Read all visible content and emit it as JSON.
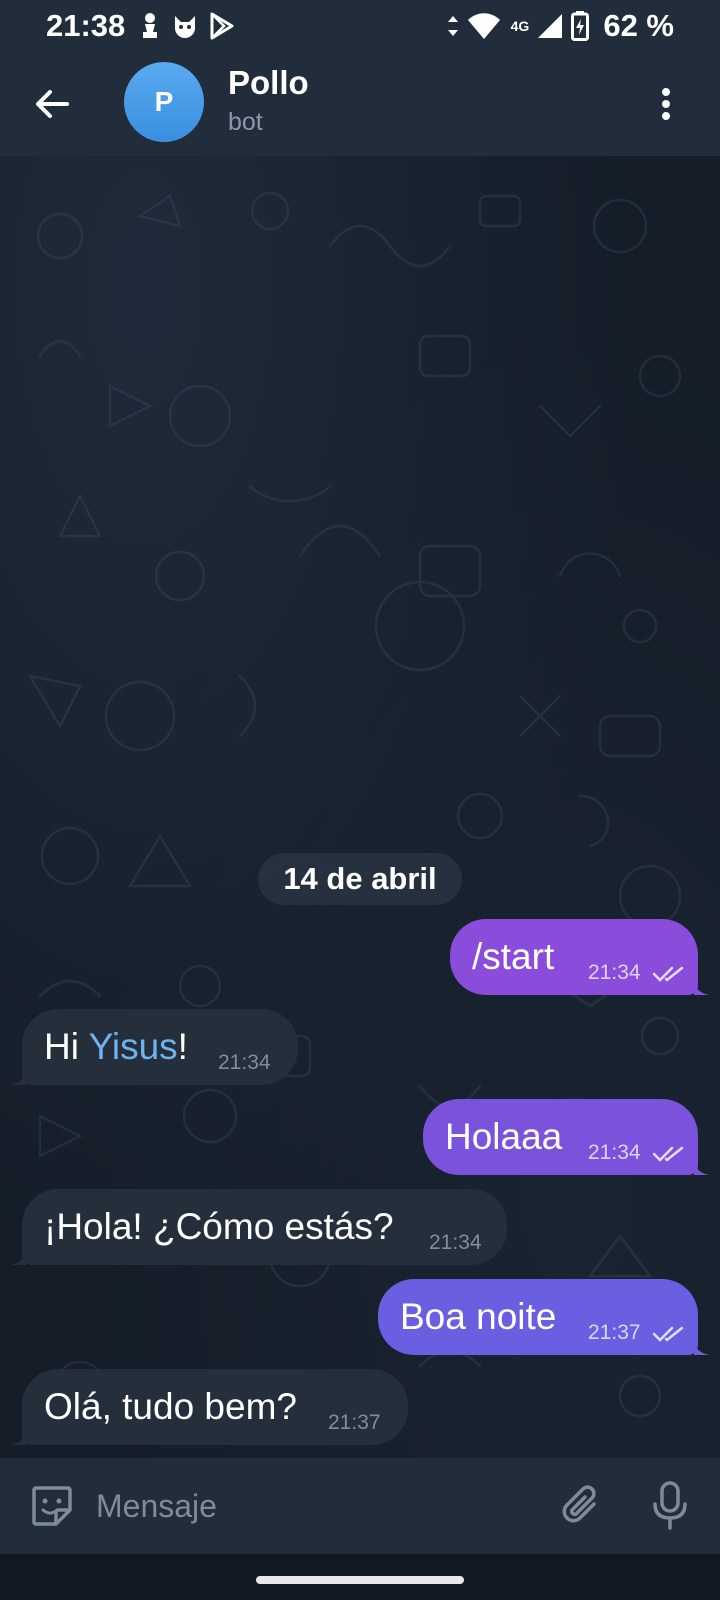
{
  "status_bar": {
    "time": "21:38",
    "network": "4G",
    "battery": "62 %",
    "icons": [
      "chess-pawn-icon",
      "cat-icon",
      "play-store-icon",
      "data-arrows-icon",
      "wifi-icon",
      "signal-icon",
      "battery-charging-icon"
    ]
  },
  "header": {
    "avatar_letter": "P",
    "title": "Pollo",
    "subtitle": "bot",
    "avatar_color": "#4a9ee8"
  },
  "chat": {
    "date_label": "14 de abril",
    "messages": [
      {
        "direction": "out",
        "text": "/start",
        "time": "21:34",
        "read": true
      },
      {
        "direction": "in",
        "text_prefix": "Hi ",
        "mention": "Yisus",
        "text_suffix": "!",
        "time": "21:34"
      },
      {
        "direction": "out",
        "text": "Holaaa",
        "time": "21:34",
        "read": true
      },
      {
        "direction": "in",
        "text": "¡Hola! ¿Cómo estás?",
        "time": "21:34"
      },
      {
        "direction": "out",
        "text": "Boa noite",
        "time": "21:37",
        "read": true
      },
      {
        "direction": "in",
        "text": "Olá, tudo bem?",
        "time": "21:37"
      }
    ],
    "outgoing_colors": [
      "#8a4ddb",
      "#7a52dc",
      "#6a5fe0"
    ],
    "incoming_color": "#252f3c",
    "mention_color": "#6fb2ef"
  },
  "composer": {
    "placeholder": "Mensaje"
  }
}
